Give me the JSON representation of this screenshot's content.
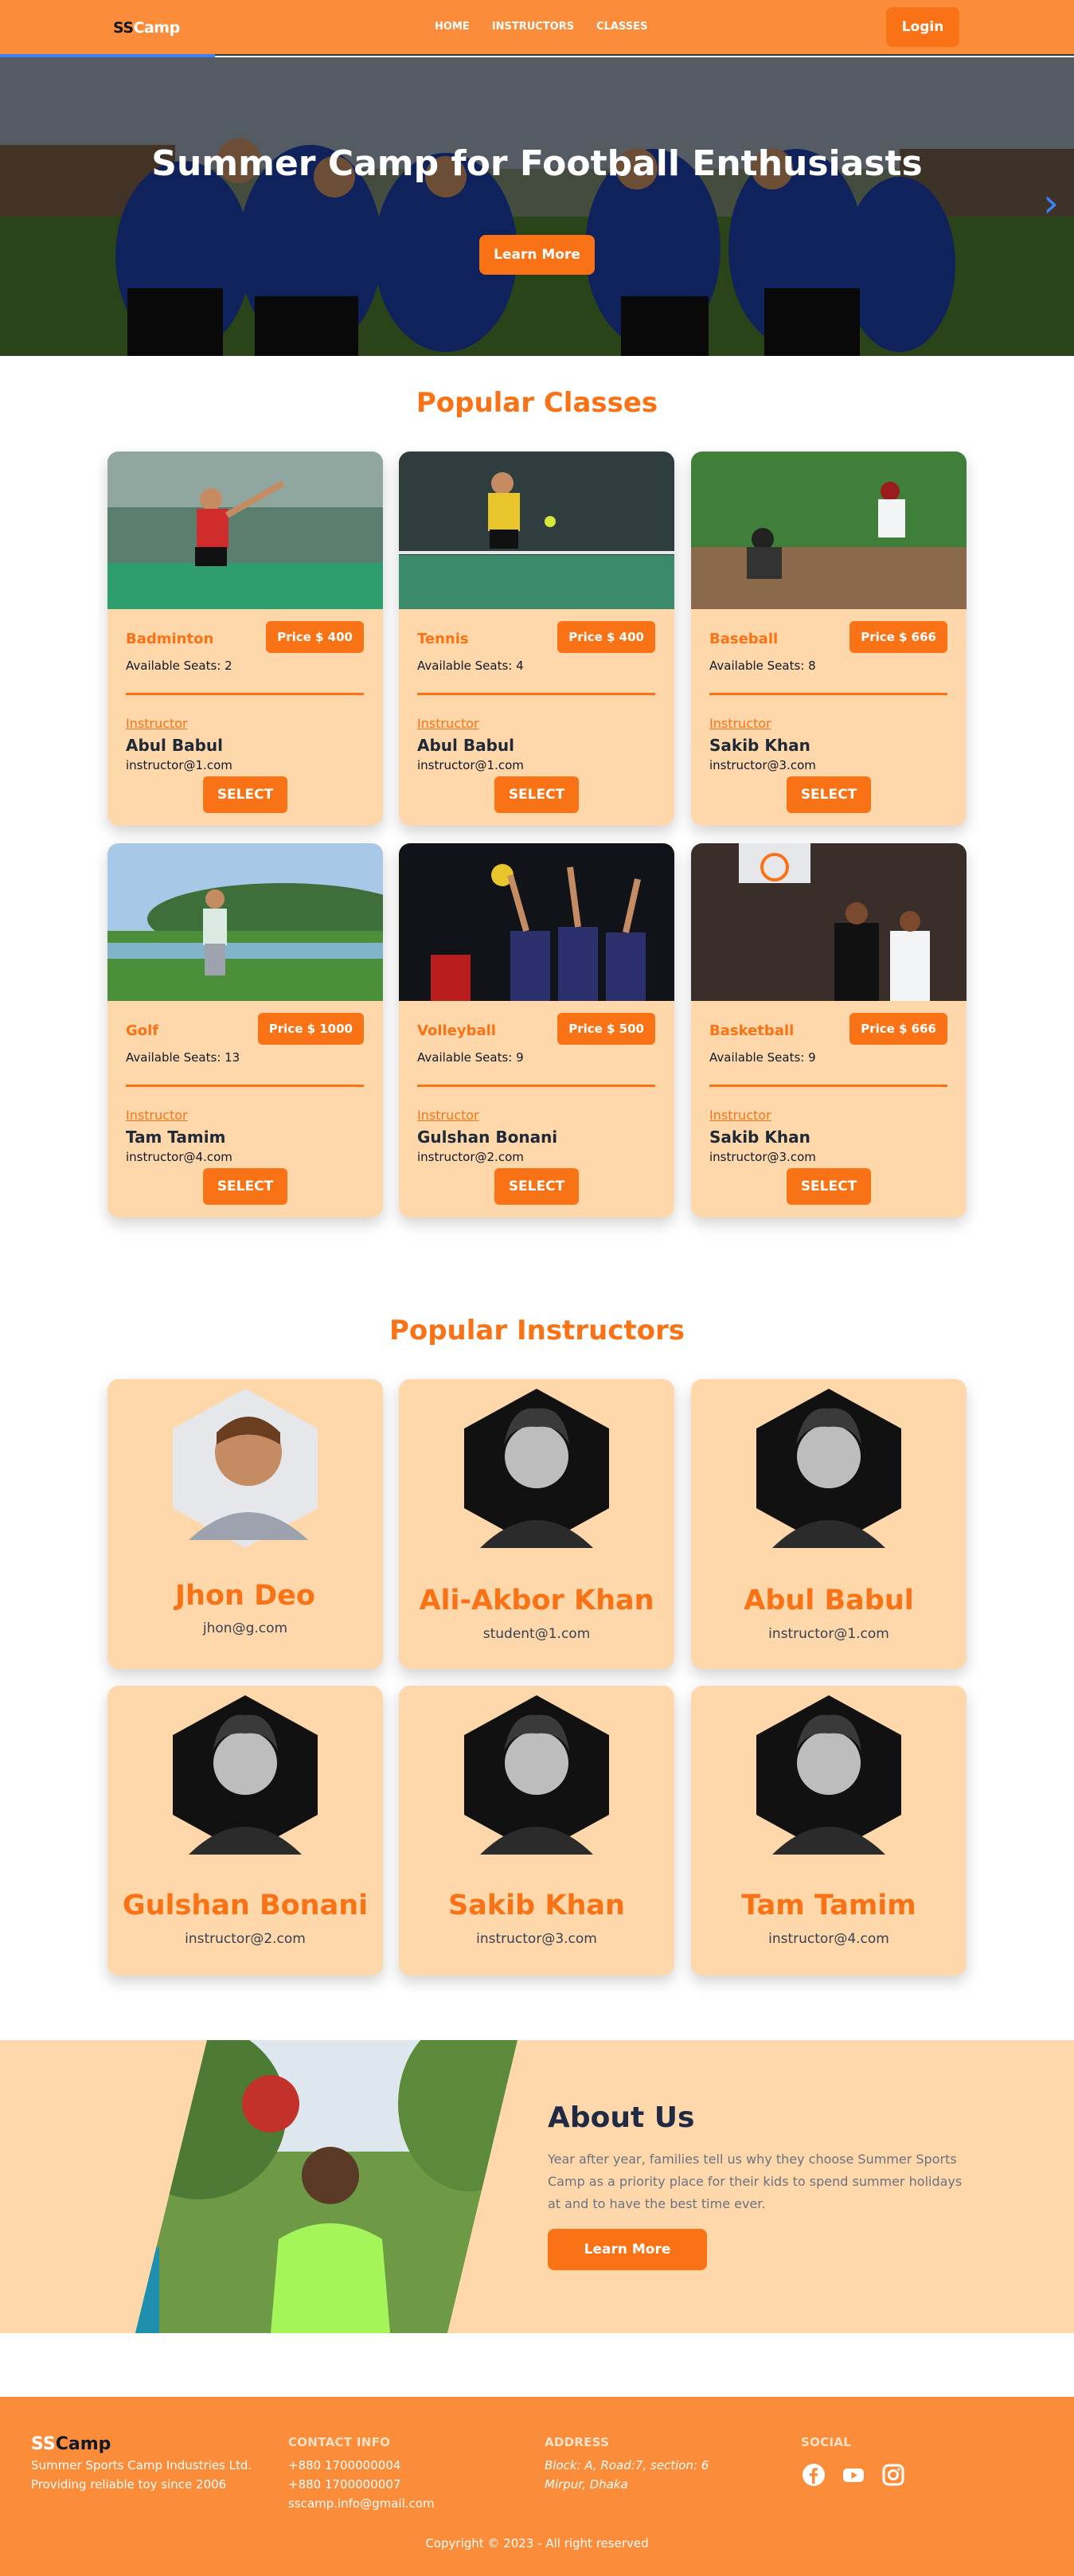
{
  "nav": {
    "logo_ss": "SS",
    "logo_camp": "Camp",
    "links": [
      "HOME",
      "INSTRUCTORS",
      "CLASSES"
    ],
    "login": "Login"
  },
  "hero": {
    "title": "Summer Camp for Football Enthusiasts",
    "button": "Learn More",
    "arrow_icon": "chevron-right-icon"
  },
  "popular_classes": {
    "title": "Popular Classes",
    "instructor_label": "Instructor",
    "select_label": "SELECT",
    "items": [
      {
        "name": "Badminton",
        "price": "Price $ 400",
        "seats": "Available Seats: 2",
        "instructor": "Abul Babul",
        "email": "instructor@1.com"
      },
      {
        "name": "Tennis",
        "price": "Price $ 400",
        "seats": "Available Seats: 4",
        "instructor": "Abul Babul",
        "email": "instructor@1.com"
      },
      {
        "name": "Baseball",
        "price": "Price $ 666",
        "seats": "Available Seats: 8",
        "instructor": "Sakib Khan",
        "email": "instructor@3.com"
      },
      {
        "name": "Golf",
        "price": "Price $ 1000",
        "seats": "Available Seats: 13",
        "instructor": "Tam Tamim",
        "email": "instructor@4.com"
      },
      {
        "name": "Volleyball",
        "price": "Price $ 500",
        "seats": "Available Seats: 9",
        "instructor": "Gulshan Bonani",
        "email": "instructor@2.com"
      },
      {
        "name": "Basketball",
        "price": "Price $ 666",
        "seats": "Available Seats: 9",
        "instructor": "Sakib Khan",
        "email": "instructor@3.com"
      }
    ]
  },
  "popular_instructors": {
    "title": "Popular Instructors",
    "items": [
      {
        "name": "Jhon Deo",
        "email": "jhon@g.com"
      },
      {
        "name": "Ali-Akbor Khan",
        "email": "student@1.com"
      },
      {
        "name": "Abul Babul",
        "email": "instructor@1.com"
      },
      {
        "name": "Gulshan Bonani",
        "email": "instructor@2.com"
      },
      {
        "name": "Sakib Khan",
        "email": "instructor@3.com"
      },
      {
        "name": "Tam Tamim",
        "email": "instructor@4.com"
      }
    ]
  },
  "about": {
    "title": "About Us",
    "text": "Year after year, families tell us why they choose Summer Sports Camp as a priority place for their kids to spend summer holidays at and to have the best time ever.",
    "button": "Learn More"
  },
  "footer": {
    "logo_ss": "SS",
    "logo_camp": "Camp",
    "tagline1": "Summer Sports Camp Industries Ltd.",
    "tagline2": "Providing reliable toy since 2006",
    "contact_head": "CONTACT INFO",
    "phone1": "+880 1700000004",
    "phone2": "+880 1700000007",
    "email": "sscamp.info@gmail.com",
    "address_head": "ADDRESS",
    "address1": "Block: A, Road:7, section: 6",
    "address2": "Mirpur, Dhaka",
    "social_head": "SOCIAL",
    "social_icons": [
      "facebook-icon",
      "youtube-icon",
      "instagram-icon"
    ],
    "copyright": "Copyright © 2023 - All right reserved"
  },
  "colors": {
    "brand": "#f97316",
    "nav_bg": "#fb8c3a",
    "card_bg": "#fed7aa"
  }
}
